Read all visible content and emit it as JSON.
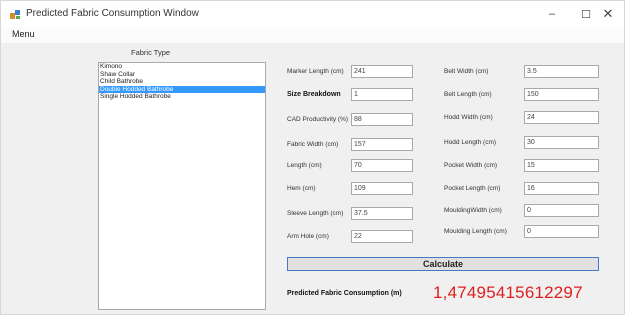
{
  "window": {
    "title": "Predicted Fabric Consumption Window",
    "minimize": "–",
    "maximize": "☐",
    "close": "✕"
  },
  "menu": {
    "label": "Menu"
  },
  "fabric_type": {
    "label": "Fabric Type",
    "items": [
      "Kimono",
      "Shaw Collar",
      "Child Bathrobe",
      "Double Hodded Bathrobe",
      "Single Hodded Bathrobe"
    ],
    "selected_index": 3
  },
  "fields_left": [
    {
      "label": "Marker Length (cm)",
      "value": "241",
      "bold": false
    },
    {
      "label": "Size Breakdown",
      "value": "1",
      "bold": true
    },
    {
      "label": "CAD Productivity (%)",
      "value": "88",
      "bold": false
    },
    {
      "label": "Fabric Width (cm)",
      "value": "157",
      "bold": false
    },
    {
      "label": "Length (cm)",
      "value": "70",
      "bold": false
    },
    {
      "label": "Hem (cm)",
      "value": "109",
      "bold": false
    },
    {
      "label": "Sleeve Length (cm)",
      "value": "37.5",
      "bold": false
    },
    {
      "label": "Arm Hole (cm)",
      "value": "22",
      "bold": false
    }
  ],
  "fields_right": [
    {
      "label": "Belt Width (cm)",
      "value": "3.5"
    },
    {
      "label": "Belt Length (cm)",
      "value": "150"
    },
    {
      "label": "Hodd    Width (cm)",
      "value": "24"
    },
    {
      "label": "Hodd    Length (cm)",
      "value": "30"
    },
    {
      "label": "Pocket Width (cm)",
      "value": "15"
    },
    {
      "label": "Pocket Length (cm)",
      "value": "16"
    },
    {
      "label": "MouldingWidth (cm)",
      "value": "0"
    },
    {
      "label": "Moulding Length (cm)",
      "value": "0"
    }
  ],
  "calculate": {
    "label": "Calculate"
  },
  "result": {
    "label": "Predicted Fabric Consumption (m)",
    "value": "1,47495415612297",
    "color": "#e01e1e"
  },
  "colors": {
    "selection": "#3399ff",
    "button_border": "#4a78c8"
  }
}
